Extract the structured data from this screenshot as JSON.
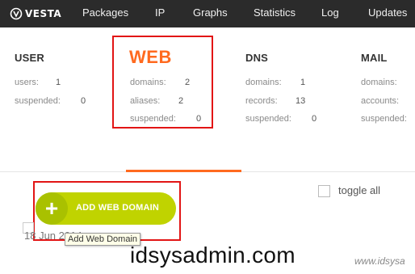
{
  "brand": {
    "logo_text": "VESTA"
  },
  "nav": {
    "items": [
      {
        "label": "Packages"
      },
      {
        "label": "IP"
      },
      {
        "label": "Graphs"
      },
      {
        "label": "Statistics"
      },
      {
        "label": "Log"
      },
      {
        "label": "Updates"
      }
    ]
  },
  "stats": {
    "user": {
      "title": "USER",
      "rows": [
        {
          "label": "users:",
          "value": "1"
        },
        {
          "label": "suspended:",
          "value": "0"
        }
      ]
    },
    "web": {
      "title": "WEB",
      "rows": [
        {
          "label": "domains:",
          "value": "2"
        },
        {
          "label": "aliases:",
          "value": "2"
        },
        {
          "label": "suspended:",
          "value": "0"
        }
      ]
    },
    "dns": {
      "title": "DNS",
      "rows": [
        {
          "label": "domains:",
          "value": "1"
        },
        {
          "label": "records:",
          "value": "13"
        },
        {
          "label": "suspended:",
          "value": "0"
        }
      ]
    },
    "mail": {
      "title": "MAIL",
      "rows": [
        {
          "label": "domains:"
        },
        {
          "label": "accounts:"
        },
        {
          "label": "suspended:"
        }
      ]
    }
  },
  "actions": {
    "add_label": "ADD WEB DOMAIN",
    "add_tooltip": "Add Web Domain",
    "toggle_all_label": "toggle all"
  },
  "list": {
    "first_row_date": "18 Jun 2014"
  },
  "watermark": {
    "main": "idsysadmin.com",
    "corner": "www.idsysa"
  },
  "colors": {
    "topbar": "#2b2b2b",
    "accent": "#ff6a1f",
    "add_button": "#c0d300",
    "highlight_box": "#e21515"
  }
}
